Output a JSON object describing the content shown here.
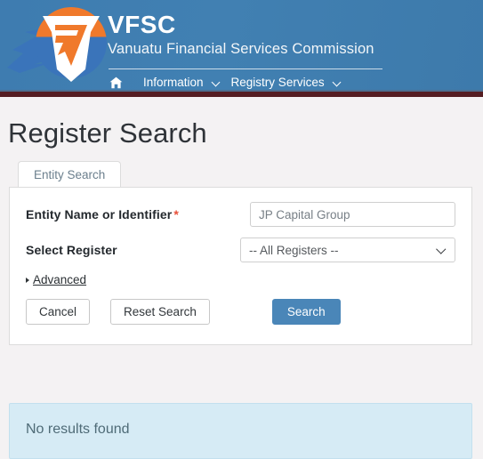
{
  "header": {
    "logo_icon": "vfsc-shield-logo",
    "brand_acronym": "VFSC",
    "brand_full_name": "Vanuatu Financial Services Commission",
    "nav": {
      "home_icon": "home-icon",
      "items": [
        {
          "label": "Information",
          "has_dropdown": true,
          "caret_icon": "chevron-down-icon"
        },
        {
          "label": "Registry Services",
          "has_dropdown": true,
          "caret_icon": "chevron-down-icon"
        }
      ]
    },
    "colors": {
      "header_blue": "#3f7cb0",
      "accent_bar": "#551d22",
      "logo_orange": "#f0792b",
      "logo_blue": "#3a74ba"
    }
  },
  "page": {
    "title": "Register Search"
  },
  "tabs": [
    {
      "label": "Entity Search",
      "active": true
    }
  ],
  "form": {
    "fields": [
      {
        "label": "Entity Name or Identifier",
        "required": true,
        "required_marker": "*",
        "value": "JP Capital Group",
        "placeholder": "JP Capital Group"
      },
      {
        "label": "Select Register",
        "required": false,
        "selected_option": "-- All Registers --",
        "options": [
          "-- All Registers --"
        ],
        "caret_icon": "chevron-down-icon"
      }
    ],
    "advanced": {
      "label": "Advanced",
      "arrow_icon": "triangle-right-icon",
      "expanded": false
    },
    "buttons": {
      "cancel": "Cancel",
      "reset": "Reset Search",
      "search": "Search",
      "search_color": "#4a86b8"
    }
  },
  "results": {
    "message": "No results found",
    "background": "#d6ebf5"
  }
}
